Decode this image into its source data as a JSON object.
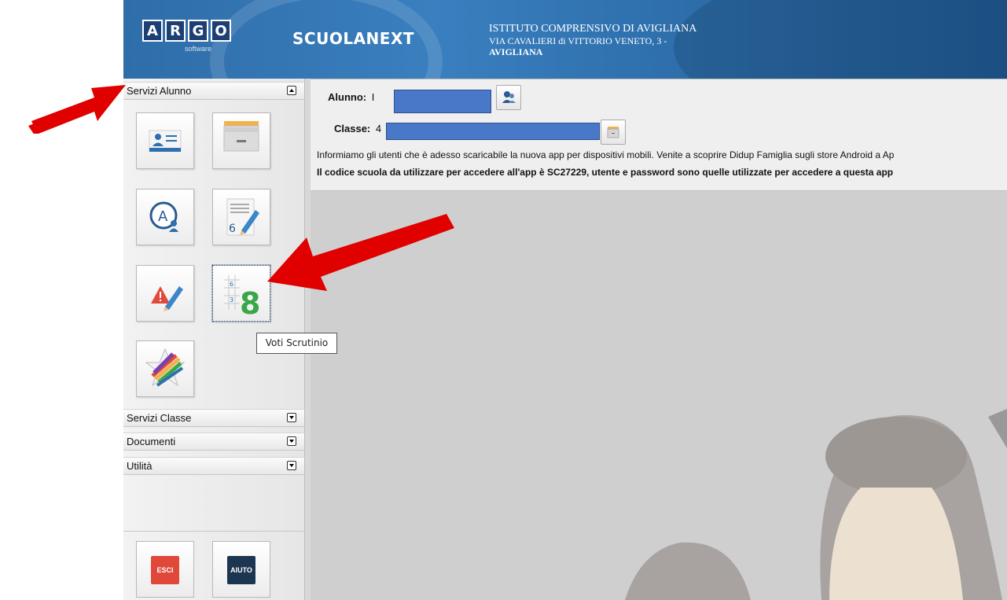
{
  "header": {
    "logo_letters": [
      "A",
      "R",
      "G",
      "O"
    ],
    "logo_sub": "software",
    "brand": "SCUOLANEXT",
    "school_name": "ISTITUTO COMPRENSIVO DI AVIGLIANA",
    "school_address": "VIA CAVALIERI di VITTORIO VENETO, 3 -",
    "school_city": "AVIGLIANA"
  },
  "sidebar": {
    "sections": {
      "servizi_alunno": "Servizi Alunno",
      "servizi_classe": "Servizi Classe",
      "documenti": "Documenti",
      "utilita": "Utilità"
    },
    "tooltip": "Voti Scrutinio",
    "grade_tile_number": "8",
    "grade_tile_small": [
      "6",
      "3"
    ],
    "grades_tile_number": "6",
    "exit_label": "ESCI",
    "help_label": "AIUTO"
  },
  "main": {
    "alunno_label": "Alunno:",
    "alunno_value": "I",
    "classe_label": "Classe:",
    "classe_value": "4",
    "notice_1": "Informiamo gli utenti che è adesso scaricabile la nuova app per dispositivi mobili. Venite a scoprire Didup Famiglia sugli store Android a Ap",
    "notice_2": "Il codice scuola da utilizzare per accedere all'app è SC27229, utente e password sono quelle utilizzate per accedere a questa app"
  },
  "colors": {
    "header_blue": "#2e6da8",
    "annotation_red": "#e00000",
    "exit_red": "#e0483a",
    "help_navy": "#1c3550",
    "redaction_blue": "#4a78c8"
  },
  "icons": [
    "student-card-icon",
    "archive-icon",
    "absences-icon",
    "grades-icon",
    "notes-icon",
    "final-grades-icon",
    "star-icon",
    "user-search-icon",
    "archive-button-icon"
  ]
}
